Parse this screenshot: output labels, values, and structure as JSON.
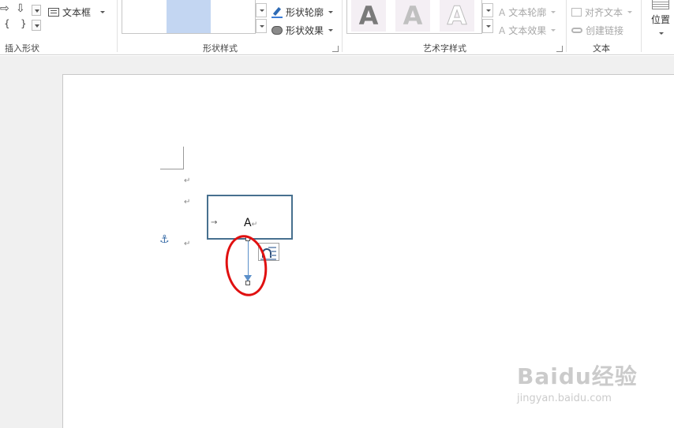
{
  "ribbon": {
    "insert_shapes": {
      "label": "插入形状",
      "glyph_right": "⇨",
      "glyph_down": "⇩",
      "glyph_brace_left": "{",
      "glyph_brace_right": "}",
      "textbox_button": "文本框"
    },
    "shape_styles": {
      "label": "形状样式",
      "outline_button": "形状轮廓",
      "effects_button": "形状效果"
    },
    "wordart_styles": {
      "label": "艺术字样式",
      "tile_letter": "A",
      "text_outline_button": "文本轮廓",
      "text_effects_button": "文本效果"
    },
    "text": {
      "label": "文本",
      "align_text_button": "对齐文本",
      "create_link_button": "创建链接"
    },
    "position": {
      "label": "位置"
    }
  },
  "document": {
    "paragraph_mark": "↵",
    "anchor_glyph": "⚓",
    "tab_mark": "→",
    "textbox_text": "A"
  },
  "watermark": {
    "main": "Baidu经验",
    "sub": "jingyan.baidu.com"
  },
  "colors": {
    "textbox_border": "#47708f",
    "connector": "#5b8fc9",
    "highlight": "#e01010",
    "style_swatch": "#c3d6f2"
  }
}
